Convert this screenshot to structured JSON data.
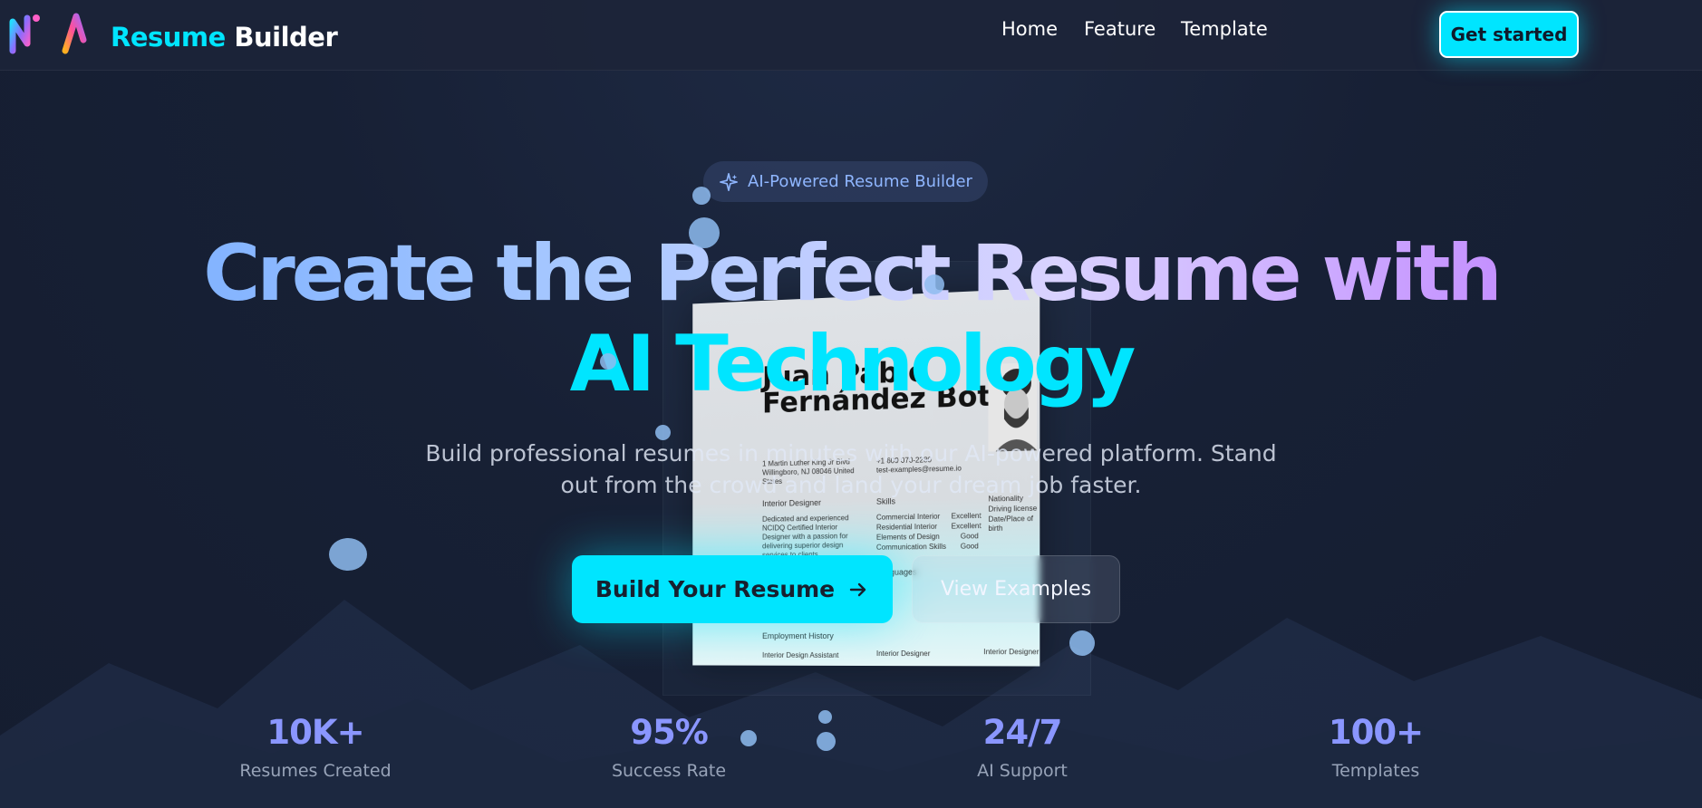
{
  "header": {
    "brand_part1": "Resume",
    "brand_part2": "Builder",
    "nav": [
      {
        "label": "Home"
      },
      {
        "label": "Feature"
      },
      {
        "label": "Template"
      }
    ],
    "cta_label": "Get started"
  },
  "hero": {
    "badge": "AI-Powered Resume Builder",
    "title_line1": "Create the Perfect Resume with",
    "title_line2": "AI Technology",
    "subtitle": "Build professional resumes in minutes with our AI-powered platform. Stand out from the crowd and land your dream job faster.",
    "primary_button": "Build Your Resume",
    "secondary_button": "View Examples"
  },
  "resume_preview": {
    "name": "Juan Pablo Fernández Botía",
    "address": "1 Martin Luther King Jr Blvd Willingboro, NJ 08046 United States",
    "phone": "+1 609 070-2280",
    "email": "test-examples@resume.io",
    "role": "Interior Designer",
    "summary": "Dedicated and experienced NCIDQ Certified Interior Designer with a passion for delivering superior design services to clients.",
    "skills_heading": "Skills",
    "skills": [
      {
        "name": "Commercial Interior",
        "level": "Excellent"
      },
      {
        "name": "Residential Interior",
        "level": "Excellent"
      },
      {
        "name": "Elements of Design",
        "level": "Good"
      },
      {
        "name": "Communication Skills",
        "level": "Good"
      }
    ],
    "details": [
      "Nationality",
      "Driving license",
      "Date/Place of birth"
    ],
    "languages_heading": "Languages",
    "employment_heading": "Employment History",
    "employment": [
      "Interior Design Assistant",
      "Interior Designer",
      "Interior Designer"
    ]
  },
  "stats": [
    {
      "value": "10K+",
      "label": "Resumes Created"
    },
    {
      "value": "95%",
      "label": "Success Rate"
    },
    {
      "value": "24/7",
      "label": "AI Support"
    },
    {
      "value": "100+",
      "label": "Templates"
    }
  ],
  "colors": {
    "accent": "#00e5ff",
    "stat_value": "#8a96ff",
    "background": "#172035"
  }
}
